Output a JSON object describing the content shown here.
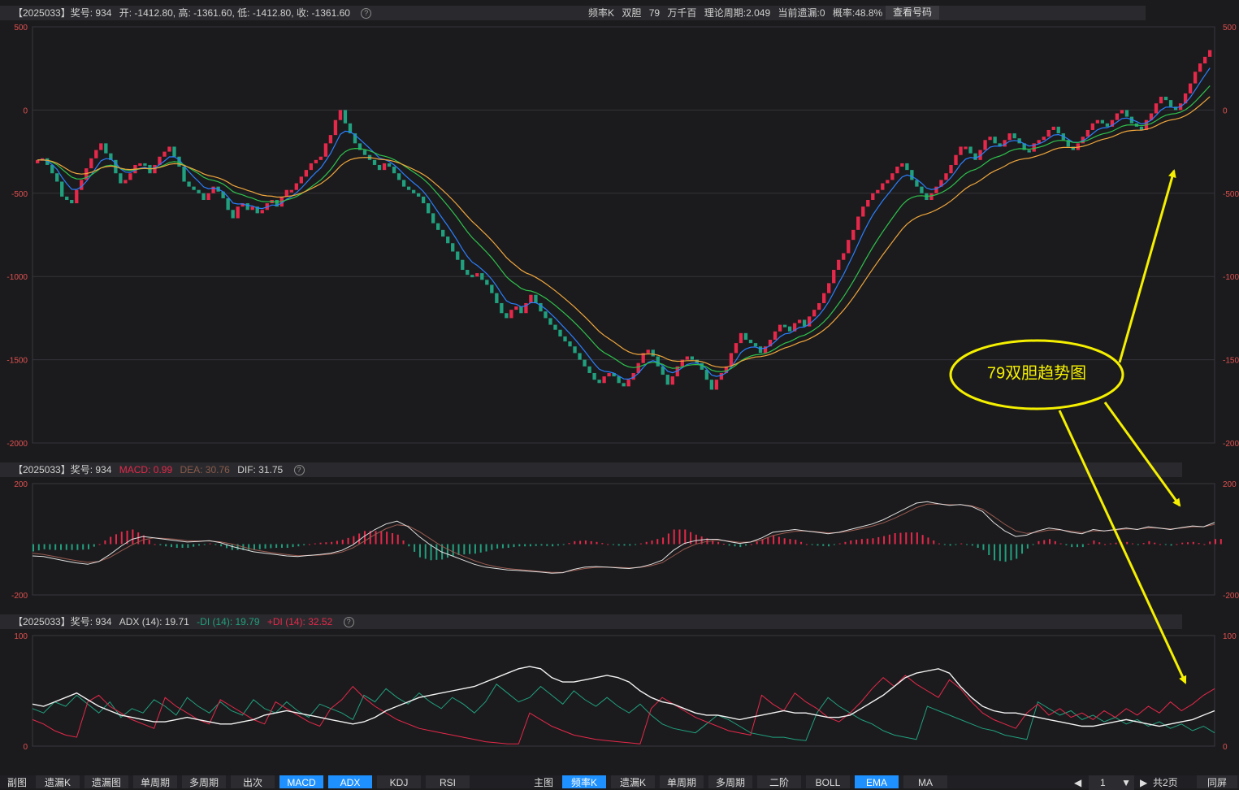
{
  "main_header": {
    "code": "【2025033】",
    "issue": "奖号: 934",
    "ohlc": "开: -1412.80, 高: -1361.60, 低: -1412.80, 收: -1361.60",
    "right_items": [
      "频率K",
      "双胆",
      "79",
      "万千百",
      "理论周期:2.049",
      "当前遗漏:0",
      "概率:48.8%"
    ],
    "view_button": "查看号码"
  },
  "macd_header": {
    "code": "【2025033】",
    "issue": "奖号: 934",
    "macd": "MACD: 0.99",
    "dea": "DEA: 30.76",
    "dif": "DIF: 31.75"
  },
  "adx_header": {
    "code": "【2025033】",
    "issue": "奖号: 934",
    "adx": "ADX (14): 19.71",
    "mdi": "-DI (14): 19.79",
    "pdi": "+DI (14): 32.52"
  },
  "annotation": {
    "text": "79双胆趋势图"
  },
  "colors": {
    "up": "#e6284a",
    "down": "#20a07e",
    "ema_fast": "#2a7fff",
    "ema_mid": "#2ec24c",
    "ema_slow": "#f0a63c",
    "ema_top": "#e8e070",
    "annotation": "#f5f000",
    "active_tab": "#1e90ff"
  },
  "tabs_left": [
    {
      "label": "副图",
      "active": false,
      "plain": true
    },
    {
      "label": "遗漏K",
      "active": false
    },
    {
      "label": "遗漏图",
      "active": false
    },
    {
      "label": "单周期",
      "active": false
    },
    {
      "label": "多周期",
      "active": false
    },
    {
      "label": "出次",
      "active": false
    },
    {
      "label": "MACD",
      "active": true
    },
    {
      "label": "ADX",
      "active": true
    },
    {
      "label": "KDJ",
      "active": false
    },
    {
      "label": "RSI",
      "active": false
    }
  ],
  "tabs_right": [
    {
      "label": "主图",
      "active": false,
      "plain": true
    },
    {
      "label": "频率K",
      "active": true
    },
    {
      "label": "遗漏K",
      "active": false
    },
    {
      "label": "单周期",
      "active": false
    },
    {
      "label": "多周期",
      "active": false
    },
    {
      "label": "二阶",
      "active": false
    },
    {
      "label": "BOLL",
      "active": false
    },
    {
      "label": "EMA",
      "active": true
    },
    {
      "label": "MA",
      "active": false
    }
  ],
  "pager": {
    "page": "1",
    "total": "共2页",
    "fullscreen": "同屏"
  },
  "chart_data": [
    {
      "type": "candlestick",
      "name": "main",
      "ylim": [
        -2000,
        500
      ],
      "yticks": [
        500,
        0,
        -500,
        -1000,
        -1500,
        -2000
      ],
      "closes": [
        -300,
        -290,
        -330,
        -380,
        -430,
        -520,
        -540,
        -560,
        -480,
        -420,
        -350,
        -290,
        -240,
        -200,
        -260,
        -300,
        -380,
        -440,
        -420,
        -380,
        -330,
        -320,
        -330,
        -380,
        -330,
        -280,
        -250,
        -220,
        -280,
        -340,
        -430,
        -460,
        -480,
        -500,
        -540,
        -500,
        -460,
        -490,
        -530,
        -600,
        -650,
        -580,
        -560,
        -600,
        -580,
        -620,
        -600,
        -560,
        -540,
        -580,
        -520,
        -480,
        -480,
        -440,
        -400,
        -360,
        -320,
        -300,
        -280,
        -200,
        -150,
        -60,
        0,
        -80,
        -140,
        -200,
        -240,
        -270,
        -300,
        -330,
        -360,
        -320,
        -340,
        -380,
        -420,
        -460,
        -480,
        -500,
        -520,
        -560,
        -620,
        -680,
        -720,
        -760,
        -800,
        -850,
        -900,
        -960,
        -990,
        -1000,
        -980,
        -1020,
        -1050,
        -1100,
        -1160,
        -1220,
        -1250,
        -1200,
        -1180,
        -1220,
        -1160,
        -1110,
        -1160,
        -1210,
        -1250,
        -1290,
        -1320,
        -1360,
        -1390,
        -1420,
        -1460,
        -1500,
        -1540,
        -1580,
        -1620,
        -1640,
        -1600,
        -1580,
        -1600,
        -1640,
        -1660,
        -1620,
        -1580,
        -1520,
        -1460,
        -1440,
        -1480,
        -1540,
        -1590,
        -1650,
        -1600,
        -1540,
        -1500,
        -1480,
        -1500,
        -1520,
        -1560,
        -1620,
        -1680,
        -1620,
        -1580,
        -1540,
        -1460,
        -1400,
        -1340,
        -1380,
        -1400,
        -1420,
        -1460,
        -1420,
        -1380,
        -1330,
        -1290,
        -1300,
        -1330,
        -1280,
        -1260,
        -1300,
        -1240,
        -1200,
        -1160,
        -1100,
        -1040,
        -960,
        -900,
        -860,
        -780,
        -720,
        -640,
        -580,
        -540,
        -500,
        -480,
        -440,
        -420,
        -380,
        -340,
        -320,
        -360,
        -420,
        -460,
        -500,
        -540,
        -500,
        -460,
        -420,
        -380,
        -330,
        -270,
        -220,
        -220,
        -260,
        -300,
        -240,
        -180,
        -160,
        -200,
        -220,
        -180,
        -140,
        -170,
        -200,
        -240,
        -250,
        -200,
        -180,
        -160,
        -120,
        -100,
        -140,
        -180,
        -220,
        -240,
        -200,
        -160,
        -120,
        -80,
        -60,
        -80,
        -100,
        -60,
        -20,
        0,
        -40,
        -80,
        -100,
        -120,
        -60,
        -20,
        40,
        80,
        60,
        20,
        0,
        40,
        100,
        160,
        230,
        280,
        320,
        360
      ]
    },
    {
      "type": "line",
      "name": "macd",
      "ylim": [
        -200,
        200
      ],
      "yticks": [
        200,
        -200
      ],
      "series": [
        {
          "values": [
            -60,
            -62,
            -70,
            -78,
            -85,
            -90,
            -80,
            -55,
            -25,
            0,
            10,
            5,
            0,
            -5,
            -10,
            -8,
            -5,
            -12,
            -25,
            -35,
            -45,
            -50,
            -55,
            -60,
            -62,
            -58,
            -55,
            -50,
            -40,
            -20,
            10,
            35,
            55,
            65,
            45,
            10,
            -20,
            -45,
            -60,
            -75,
            -90,
            -100,
            -105,
            -110,
            -112,
            -115,
            -118,
            -122,
            -120,
            -108,
            -100,
            -98,
            -100,
            -103,
            -105,
            -100,
            -90,
            -75,
            -40,
            -15,
            -5,
            0,
            0,
            -8,
            -15,
            -10,
            5,
            25,
            30,
            35,
            30,
            25,
            20,
            25,
            35,
            45,
            55,
            70,
            90,
            110,
            130,
            135,
            128,
            122,
            125,
            118,
            100,
            60,
            30,
            10,
            15,
            30,
            40,
            35,
            25,
            20,
            35,
            30,
            35,
            40,
            35,
            45,
            40,
            35,
            42,
            48,
            45,
            60
          ]
        },
        {
          "values": [
            -50,
            -55,
            -62,
            -70,
            -77,
            -83,
            -80,
            -65,
            -42,
            -20,
            -2,
            5,
            3,
            0,
            -5,
            -6,
            -6,
            -9,
            -17,
            -27,
            -37,
            -44,
            -50,
            -55,
            -59,
            -58,
            -57,
            -53,
            -46,
            -31,
            -8,
            17,
            38,
            52,
            48,
            28,
            2,
            -24,
            -44,
            -61,
            -77,
            -90,
            -99,
            -105,
            -109,
            -112,
            -116,
            -119,
            -119,
            -112,
            -105,
            -101,
            -100,
            -101,
            -103,
            -101,
            -95,
            -84,
            -60,
            -35,
            -18,
            -8,
            -3,
            -6,
            -11,
            -10,
            -2,
            13,
            22,
            29,
            30,
            27,
            23,
            24,
            30,
            38,
            47,
            59,
            75,
            94,
            114,
            126,
            127,
            124,
            124,
            120,
            108,
            82,
            54,
            30,
            21,
            26,
            33,
            34,
            29,
            24,
            30,
            30,
            33,
            37,
            36,
            41,
            40,
            37,
            40,
            45,
            45,
            53
          ]
        }
      ]
    },
    {
      "type": "line",
      "name": "adx",
      "ylim": [
        0,
        100
      ],
      "yticks": [
        100,
        0
      ],
      "series": [
        {
          "name": "ADX",
          "values": [
            38,
            36,
            40,
            44,
            48,
            42,
            36,
            32,
            28,
            26,
            24,
            22,
            22,
            24,
            26,
            24,
            22,
            20,
            20,
            22,
            24,
            28,
            30,
            32,
            30,
            28,
            26,
            24,
            22,
            20,
            22,
            26,
            32,
            36,
            40,
            44,
            46,
            48,
            50,
            52,
            54,
            58,
            62,
            66,
            70,
            72,
            70,
            62,
            58,
            58,
            60,
            62,
            64,
            62,
            58,
            50,
            44,
            40,
            38,
            34,
            30,
            28,
            28,
            26,
            24,
            26,
            28,
            30,
            32,
            30,
            30,
            28,
            26,
            26,
            28,
            34,
            40,
            46,
            54,
            62,
            66,
            68,
            70,
            66,
            54,
            44,
            36,
            32,
            30,
            30,
            28,
            26,
            24,
            22,
            20,
            18,
            18,
            20,
            22,
            24,
            22,
            20,
            18,
            20,
            22,
            24,
            28,
            32
          ]
        },
        {
          "name": "-DI",
          "values": [
            34,
            30,
            40,
            36,
            46,
            38,
            30,
            40,
            26,
            34,
            30,
            42,
            36,
            28,
            44,
            36,
            30,
            40,
            32,
            28,
            42,
            34,
            30,
            40,
            32,
            26,
            38,
            34,
            30,
            24,
            46,
            40,
            52,
            44,
            38,
            48,
            40,
            34,
            44,
            38,
            30,
            40,
            56,
            48,
            40,
            44,
            54,
            46,
            38,
            50,
            42,
            36,
            44,
            36,
            30,
            38,
            28,
            20,
            16,
            14,
            12,
            20,
            28,
            24,
            18,
            12,
            10,
            8,
            8,
            6,
            5,
            30,
            44,
            36,
            30,
            24,
            20,
            14,
            10,
            8,
            6,
            36,
            32,
            28,
            24,
            20,
            16,
            14,
            10,
            8,
            6,
            40,
            34,
            28,
            32,
            24,
            28,
            22,
            26,
            20,
            24,
            18,
            22,
            16,
            20,
            14,
            18,
            12
          ]
        },
        {
          "name": "+DI",
          "values": [
            24,
            20,
            14,
            10,
            8,
            40,
            46,
            36,
            30,
            24,
            20,
            16,
            44,
            36,
            30,
            24,
            20,
            42,
            36,
            30,
            24,
            20,
            40,
            34,
            28,
            22,
            18,
            34,
            42,
            54,
            44,
            36,
            30,
            24,
            20,
            16,
            14,
            12,
            10,
            8,
            6,
            4,
            3,
            2,
            2,
            30,
            24,
            18,
            14,
            10,
            8,
            6,
            5,
            4,
            3,
            2,
            34,
            44,
            38,
            32,
            26,
            22,
            18,
            14,
            12,
            10,
            46,
            38,
            32,
            48,
            40,
            34,
            26,
            22,
            30,
            40,
            52,
            62,
            54,
            64,
            56,
            50,
            44,
            60,
            52,
            40,
            30,
            24,
            20,
            16,
            30,
            38,
            28,
            34,
            26,
            30,
            24,
            32,
            26,
            34,
            28,
            36,
            30,
            40,
            32,
            38,
            46,
            52
          ]
        }
      ]
    }
  ]
}
